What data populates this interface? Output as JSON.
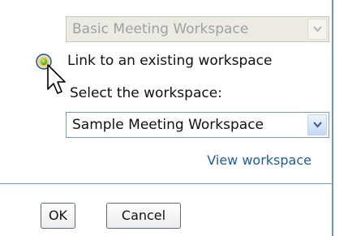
{
  "panel": {
    "cut_off_text": "",
    "workspace_template_select": {
      "value": "Basic Meeting Workspace",
      "disabled": true,
      "icon": "chevron-down-icon"
    },
    "link_existing_radio": {
      "label": "Link to an existing workspace",
      "checked": true
    },
    "select_workspace_label": "Select the workspace:",
    "workspace_select": {
      "value": "Sample Meeting Workspace",
      "icon": "chevron-down-icon"
    },
    "view_workspace_link": "View workspace",
    "buttons": {
      "ok": "OK",
      "cancel": "Cancel"
    }
  },
  "colors": {
    "border_accent": "#6f95c4",
    "link": "#1e5b9e",
    "radio_selected": "#8bbf3a"
  }
}
